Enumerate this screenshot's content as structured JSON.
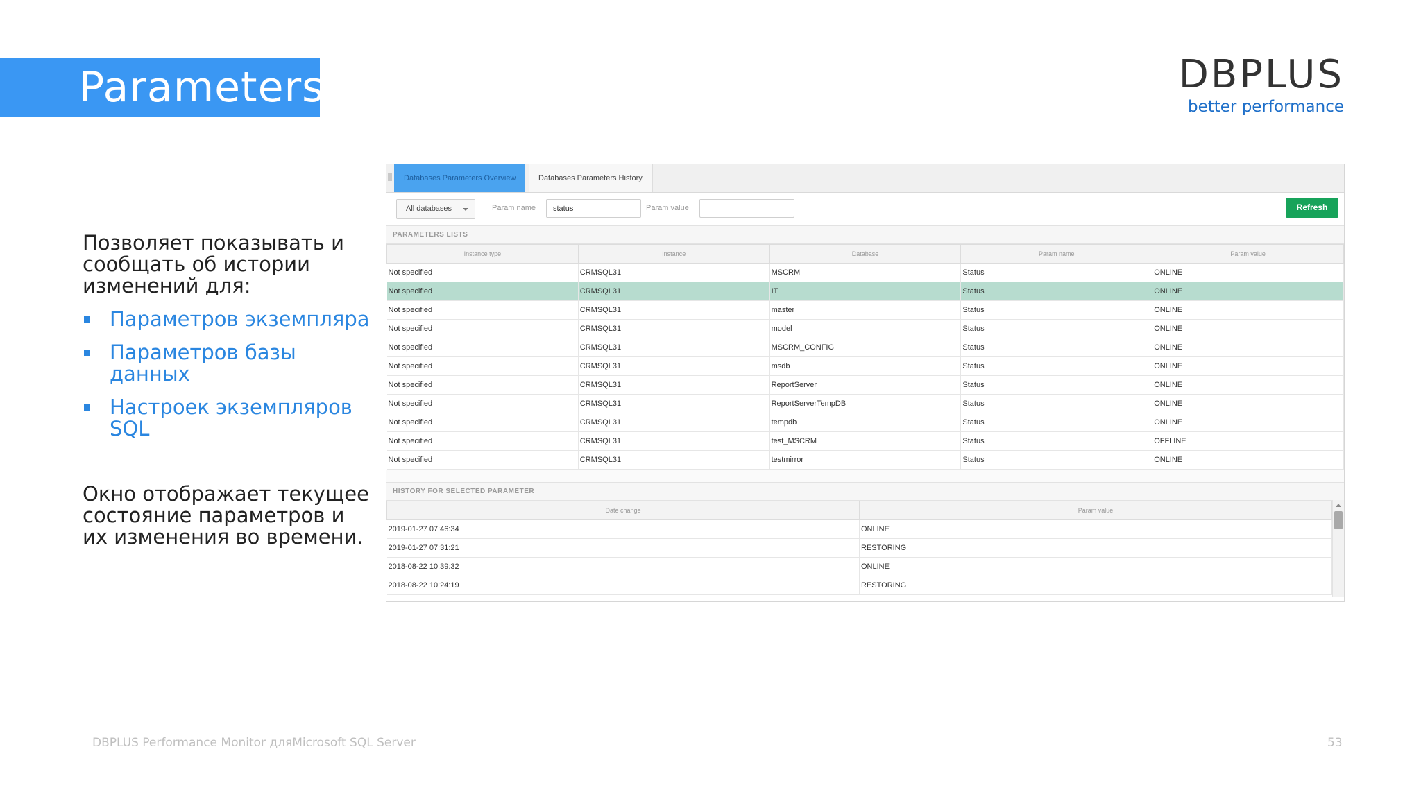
{
  "slide": {
    "title": "Parameters",
    "logo_main": "DBPLUS",
    "logo_sub": "better performance",
    "intro": "Позволяет показывать и сообщать об истории изменений для:",
    "bullets": [
      "Параметров экземпляра",
      "Параметров базы данных",
      "Настроек экземпляров SQL"
    ],
    "outro": "Окно отображает текущее состояние параметров и их изменения во времени.",
    "footer_left": "DBPLUS Performance Monitor дляMicrosoft SQL Server",
    "footer_page": "53"
  },
  "app": {
    "tabs": [
      {
        "label": "Databases Parameters Overview",
        "active": true
      },
      {
        "label": "Databases Parameters History",
        "active": false
      }
    ],
    "toolbar": {
      "database_select": "All databases",
      "param_name_label": "Param name",
      "param_name_value": "status",
      "param_value_label": "Param value",
      "param_value_value": "",
      "refresh_label": "Refresh"
    },
    "parameters": {
      "section_title": "PARAMETERS LISTS",
      "columns": [
        "Instance type",
        "Instance",
        "Database",
        "Param name",
        "Param value"
      ],
      "rows": [
        [
          "Not specified",
          "CRMSQL31",
          "MSCRM",
          "Status",
          "ONLINE"
        ],
        [
          "Not specified",
          "CRMSQL31",
          "IT",
          "Status",
          "ONLINE"
        ],
        [
          "Not specified",
          "CRMSQL31",
          "master",
          "Status",
          "ONLINE"
        ],
        [
          "Not specified",
          "CRMSQL31",
          "model",
          "Status",
          "ONLINE"
        ],
        [
          "Not specified",
          "CRMSQL31",
          "MSCRM_CONFIG",
          "Status",
          "ONLINE"
        ],
        [
          "Not specified",
          "CRMSQL31",
          "msdb",
          "Status",
          "ONLINE"
        ],
        [
          "Not specified",
          "CRMSQL31",
          "ReportServer",
          "Status",
          "ONLINE"
        ],
        [
          "Not specified",
          "CRMSQL31",
          "ReportServerTempDB",
          "Status",
          "ONLINE"
        ],
        [
          "Not specified",
          "CRMSQL31",
          "tempdb",
          "Status",
          "ONLINE"
        ],
        [
          "Not specified",
          "CRMSQL31",
          "test_MSCRM",
          "Status",
          "OFFLINE"
        ],
        [
          "Not specified",
          "CRMSQL31",
          "testmirror",
          "Status",
          "ONLINE"
        ]
      ],
      "selected_row": 1
    },
    "history": {
      "section_title": "HISTORY FOR SELECTED PARAMETER",
      "columns": [
        "Date change",
        "Param value"
      ],
      "rows": [
        [
          "2019-01-27 07:46:34",
          "ONLINE"
        ],
        [
          "2019-01-27 07:31:21",
          "RESTORING"
        ],
        [
          "2018-08-22 10:39:32",
          "ONLINE"
        ],
        [
          "2018-08-22 10:24:19",
          "RESTORING"
        ]
      ]
    }
  }
}
